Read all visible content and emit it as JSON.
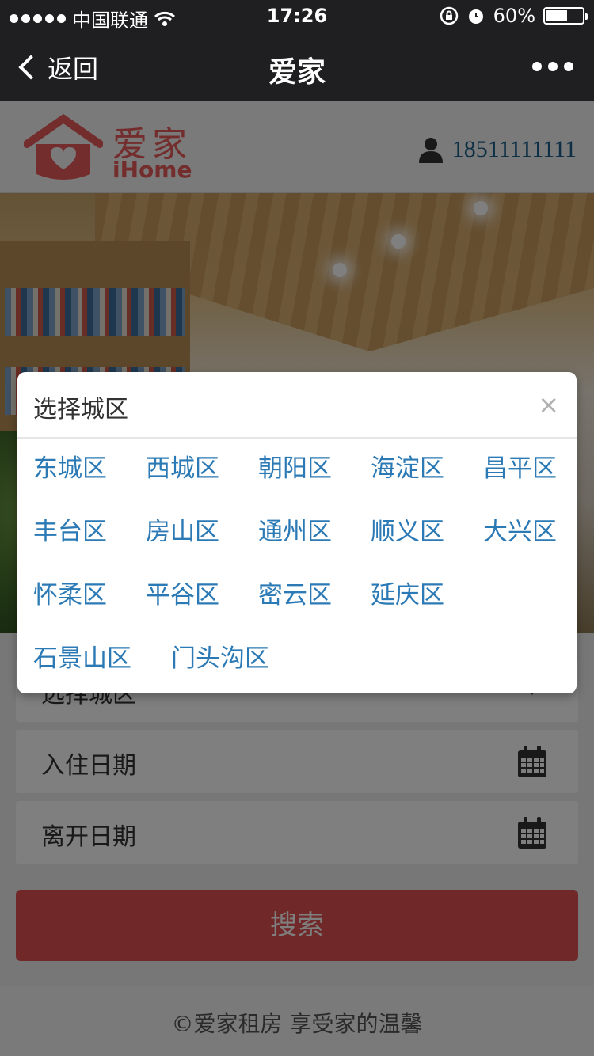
{
  "status_bar": {
    "carrier": "中国联通",
    "time": "17:26",
    "battery": "60%",
    "battery_level": 0.6
  },
  "nav": {
    "back_label": "返回",
    "title": "爱家"
  },
  "header": {
    "logo_cn": "爱家",
    "logo_en": "iHome",
    "phone": "18511111111"
  },
  "form": {
    "area_placeholder": "选择城区",
    "checkin_label": "入住日期",
    "checkout_label": "离开日期",
    "search_label": "搜索"
  },
  "footer": {
    "text": "©爱家租房  享受家的温馨"
  },
  "modal": {
    "title": "选择城区",
    "close": "×",
    "districts": [
      "东城区",
      "西城区",
      "朝阳区",
      "海淀区",
      "昌平区",
      "丰台区",
      "房山区",
      "通州区",
      "顺义区",
      "大兴区",
      "怀柔区",
      "平谷区",
      "密云区",
      "延庆区",
      "石景山区",
      "门头沟区"
    ]
  },
  "colors": {
    "accent": "#e05050",
    "link": "#2c7ab5",
    "bar": "#1f1f21"
  }
}
